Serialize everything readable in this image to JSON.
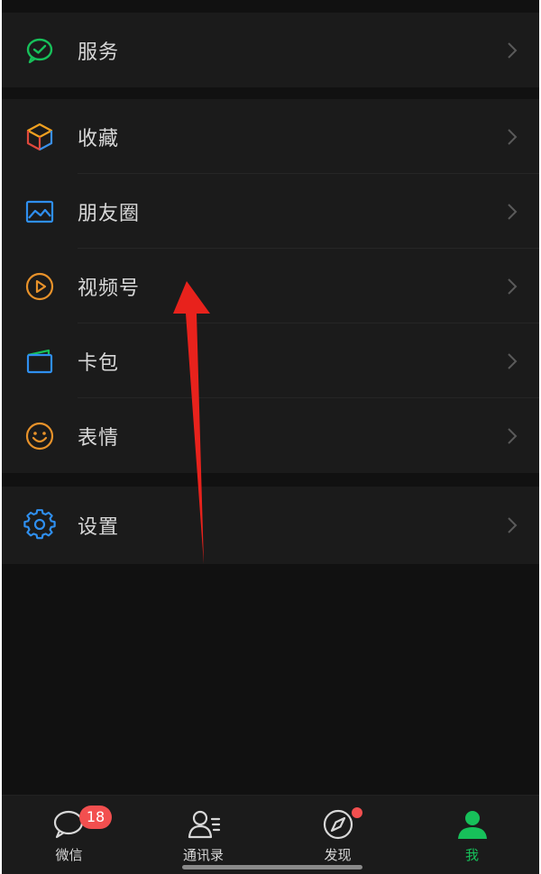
{
  "colors": {
    "background": "#111111",
    "cell": "#1b1b1b",
    "text": "#d8d8d8",
    "active_green": "#17c05a",
    "badge_red": "#f24f4f",
    "annotation_red": "#e8221c"
  },
  "services": {
    "label": "服务",
    "icon": "services-wechat-icon"
  },
  "menu": {
    "favorites": {
      "label": "收藏",
      "icon": "cube-icon"
    },
    "moments": {
      "label": "朋友圈",
      "icon": "image-icon"
    },
    "channels": {
      "label": "视频号",
      "icon": "play-circle-icon"
    },
    "cards": {
      "label": "卡包",
      "icon": "card-wallet-icon"
    },
    "stickers": {
      "label": "表情",
      "icon": "smiley-icon"
    }
  },
  "settings": {
    "label": "设置",
    "icon": "gear-icon"
  },
  "tabbar": {
    "chats": {
      "label": "微信",
      "badge": "18"
    },
    "contacts": {
      "label": "通讯录"
    },
    "discover": {
      "label": "发现"
    },
    "me": {
      "label": "我",
      "active": true
    }
  }
}
